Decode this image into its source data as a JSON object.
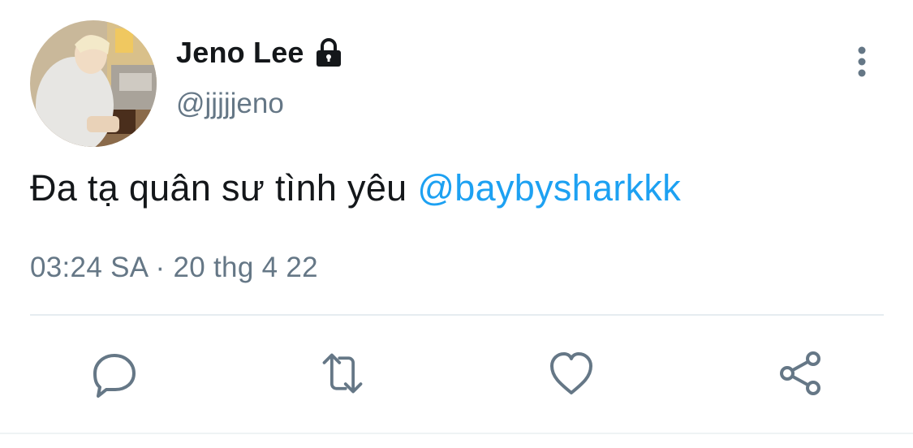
{
  "tweet": {
    "author": {
      "display_name": "Jeno Lee",
      "handle": "@jjjjjeno",
      "protected": true,
      "avatar_icon": "avatar-photo"
    },
    "text": "Đa tạ quân sư tình yêu ",
    "mention": "@baybysharkkk",
    "timestamp": "03:24 SA · 20 thg 4 22",
    "more_icon": "more-vertical-icon"
  },
  "actions": [
    {
      "name": "reply",
      "icon": "reply-icon"
    },
    {
      "name": "retweet",
      "icon": "retweet-icon"
    },
    {
      "name": "like",
      "icon": "heart-icon"
    },
    {
      "name": "share",
      "icon": "share-icon"
    }
  ],
  "colors": {
    "text": "#14171a",
    "secondary": "#657786",
    "link": "#1da1f2",
    "divider": "#e6ecf0"
  }
}
